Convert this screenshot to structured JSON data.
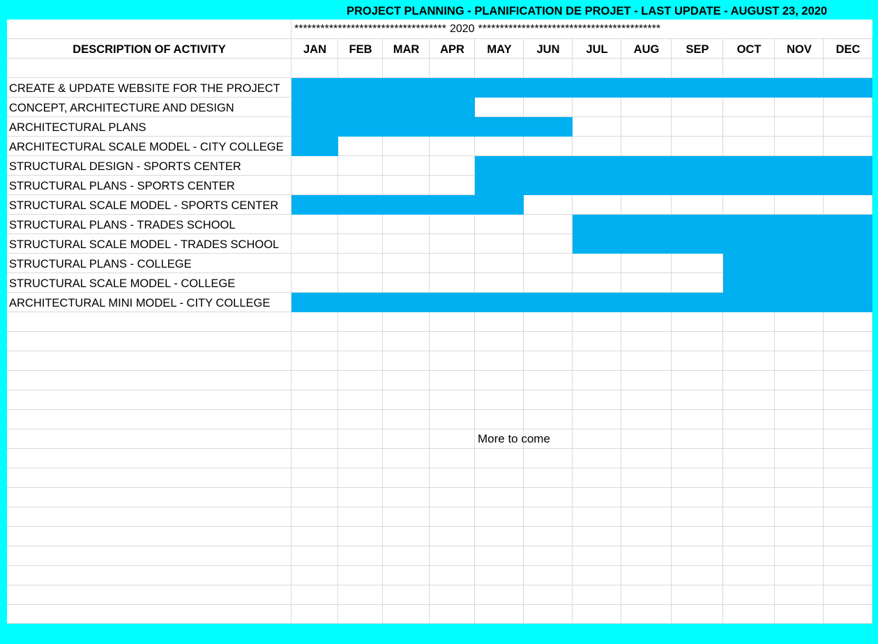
{
  "title": "PROJECT PLANNING - PLANIFICATION DE PROJET - LAST UPDATE - AUGUST 23, 2020",
  "year_banner": {
    "stars_left": "***********************************",
    "year": "2020",
    "stars_right": "******************************************"
  },
  "header": {
    "description": "DESCRIPTION OF ACTIVITY",
    "months": [
      "JAN",
      "FEB",
      "MAR",
      "APR",
      "MAY",
      "JUN",
      "JUL",
      "AUG",
      "SEP",
      "OCT",
      "NOV",
      "DEC"
    ]
  },
  "activities": [
    {
      "label": "CREATE & UPDATE WEBSITE FOR THE PROJECT",
      "start": "JAN",
      "end": "DEC"
    },
    {
      "label": "CONCEPT, ARCHITECTURE AND DESIGN",
      "start": "JAN",
      "end": "APR"
    },
    {
      "label": "ARCHITECTURAL PLANS",
      "start": "JAN",
      "end": "JUN"
    },
    {
      "label": "ARCHITECTURAL SCALE MODEL - CITY COLLEGE",
      "start": "JAN",
      "end": "JAN"
    },
    {
      "label": "STRUCTURAL DESIGN - SPORTS CENTER",
      "start": "MAY",
      "end": "DEC"
    },
    {
      "label": "STRUCTURAL PLANS - SPORTS CENTER",
      "start": "MAY",
      "end": "DEC"
    },
    {
      "label": "STRUCTURAL SCALE MODEL - SPORTS CENTER",
      "start": "JAN",
      "end": "MAY"
    },
    {
      "label": "STRUCTURAL PLANS - TRADES SCHOOL",
      "start": "JUL",
      "end": "DEC"
    },
    {
      "label": "STRUCTURAL SCALE MODEL - TRADES SCHOOL",
      "start": "JUL",
      "end": "DEC"
    },
    {
      "label": "STRUCTURAL PLANS - COLLEGE",
      "start": "OCT",
      "end": "DEC"
    },
    {
      "label": "STRUCTURAL SCALE MODEL - COLLEGE",
      "start": "OCT",
      "end": "DEC"
    },
    {
      "label": "ARCHITECTURAL MINI MODEL - CITY COLLEGE",
      "start": "JAN",
      "end": "DEC"
    }
  ],
  "footer_note": "More to come",
  "colors": {
    "background": "#00ffff",
    "bar": "#00b0f0",
    "grid": "#d9d9d9"
  }
}
